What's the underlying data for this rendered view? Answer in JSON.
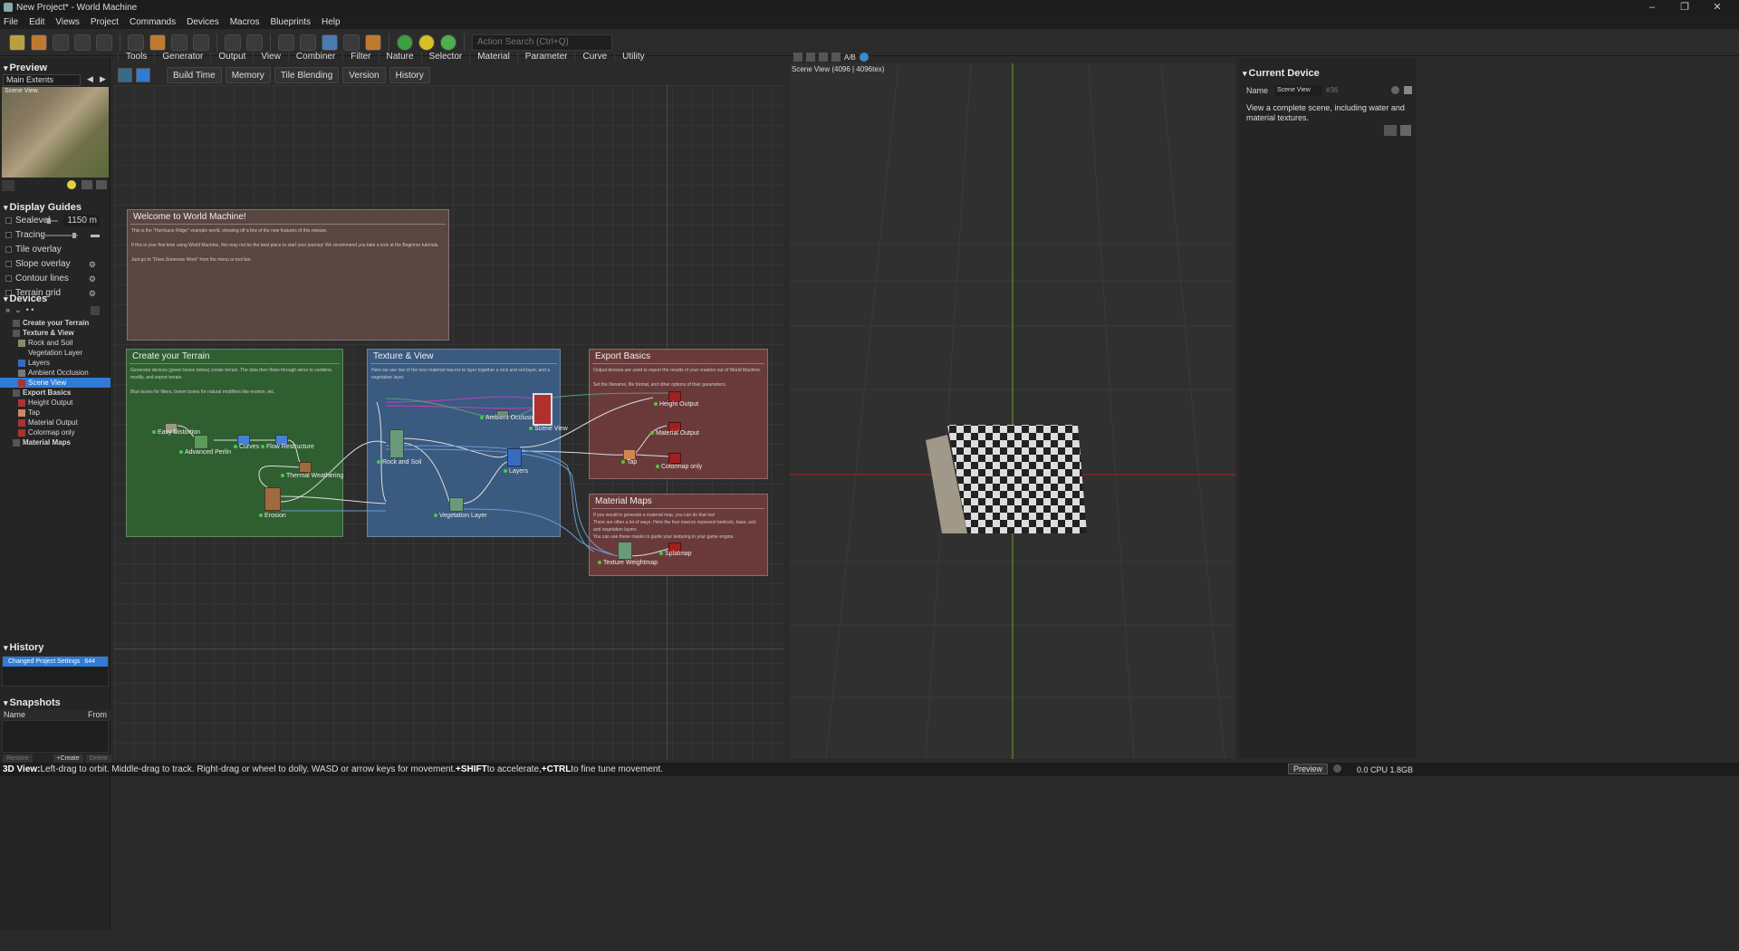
{
  "window": {
    "title": "New Project* - World Machine",
    "controls": [
      "–",
      "❐",
      "✕"
    ]
  },
  "menu": [
    "File",
    "Edit",
    "Views",
    "Project",
    "Commands",
    "Devices",
    "Macros",
    "Blueprints",
    "Help"
  ],
  "toolbar": {
    "search_placeholder": "Action Search (Ctrl+Q)"
  },
  "preview": {
    "title": "Preview",
    "extents": "Main Extents",
    "thumb_label": "Scene View"
  },
  "display_guides": {
    "title": "Display Guides",
    "items": [
      {
        "label": "Sealevel",
        "value": "1150 m",
        "slider": 0.35
      },
      {
        "label": "Tracing",
        "slider": 0.85
      },
      {
        "label": "Tile overlay"
      },
      {
        "label": "Slope overlay"
      },
      {
        "label": "Contour lines"
      },
      {
        "label": "Terrain grid"
      }
    ]
  },
  "devices": {
    "title": "Devices",
    "tree": [
      {
        "label": "Create your Terrain",
        "group": true
      },
      {
        "label": "Texture & View",
        "group": true
      },
      {
        "label": "Rock and Soil"
      },
      {
        "label": "Vegetation Layer"
      },
      {
        "label": "Layers"
      },
      {
        "label": "Ambient Occlusion"
      },
      {
        "label": "Scene View",
        "selected": true
      },
      {
        "label": "Export Basics",
        "group": true
      },
      {
        "label": "Height Output"
      },
      {
        "label": "Tap"
      },
      {
        "label": "Material Output"
      },
      {
        "label": "Colormap only"
      },
      {
        "label": "Material Maps",
        "group": true
      }
    ]
  },
  "history": {
    "title": "History",
    "items": [
      {
        "label": "Changed Project Settings",
        "size": "644"
      }
    ]
  },
  "snapshots": {
    "title": "Snapshots",
    "columns": [
      "Name",
      "From"
    ],
    "buttons": [
      "Restore",
      "+Create",
      "Delete"
    ]
  },
  "node_tabs": [
    "Tools",
    "Generator",
    "Output",
    "View",
    "Combiner",
    "Filter",
    "Nature",
    "Selector",
    "Material",
    "Parameter",
    "Curve",
    "Utility"
  ],
  "node_tools": [
    "Build Time",
    "Memory",
    "Tile Blending",
    "Version",
    "History"
  ],
  "groups": {
    "welcome": {
      "title": "Welcome to World Machine!",
      "lines": [
        "This is the \"Hurricane Ridge\" example world, showing off a few of the new features of this release.",
        "If this is your first time using World Machine, this may not be the best place to start your journey! We recommend you take a look at the Beginner tutorials.",
        "Just go to \"Does Someone Work\" from the menu or tool bar."
      ]
    },
    "create": {
      "title": "Create your Terrain",
      "lines": [
        "Generator devices (green boxes below) create terrain. The data then flows through wires to combine, modify, and export terrain.",
        "Blue boxes for filters, brown boxes for natural modifiers like erosion, etc."
      ]
    },
    "texture": {
      "title": "Texture & View",
      "lines": [
        "Here we use two of the new material macros to layer together a rock and soil layer, and a vegetation layer."
      ]
    },
    "export": {
      "title": "Export Basics",
      "lines": [
        "Output devices are used to export the results of your creation out of World Machine.",
        "Set the filename, file format, and other options of their parameters."
      ]
    },
    "maps": {
      "title": "Material Maps",
      "lines": [
        "If you would to generate a material map, you can do that too!",
        "There are often a lot of ways. Here the four macros represent bedrock, base, soil, and vegetation layers.",
        "You can use these masks to guide your texturing in your game engine."
      ]
    }
  },
  "nodes": {
    "easy_distortion": "Easy Distortion",
    "advanced_perlin": "Advanced Perlin",
    "curves": "Curves",
    "flow_restructure": "Flow Restructure",
    "thermal_weathering": "Thermal Weathering",
    "erosion": "Erosion",
    "rock_and_soil": "Rock and Soil",
    "ambient_occlusion": "Ambient Occlusion",
    "scene_view": "Scene View",
    "layers": "Layers",
    "vegetation_layer": "Vegetation Layer",
    "height_output": "Height Output",
    "material_output": "Material Output",
    "tap": "Tap",
    "colormap_only": "Colormap only",
    "texture_weightmap": "Texture Weightmap",
    "splatmap": "Splatmap"
  },
  "view3d": {
    "title": "Scene View (4096 | 4096tex)",
    "ab_label": "A/B"
  },
  "current_device": {
    "title": "Current Device",
    "name_label": "Name",
    "name_value": "Scene View",
    "id": "#36",
    "description": "View a complete scene, including water and material textures."
  },
  "status": {
    "mode": "3D View:",
    "text": " Left-drag to orbit. Middle-drag to track. Right-drag or wheel to dolly. WASD or arrow keys for movement. ",
    "shift": "+SHIFT",
    "shift_text": " to accelerate, ",
    "ctrl": "+CTRL",
    "ctrl_text": " to fine tune movement.",
    "preview_btn": "Preview",
    "stats": "0.0 CPU 1.8GB"
  },
  "colors": {
    "selection": "#2f7bd6",
    "group_green": "#2f5f30",
    "group_blue": "#3a5a80",
    "group_red": "#6a3a3a",
    "group_welcome": "#5a4640"
  }
}
